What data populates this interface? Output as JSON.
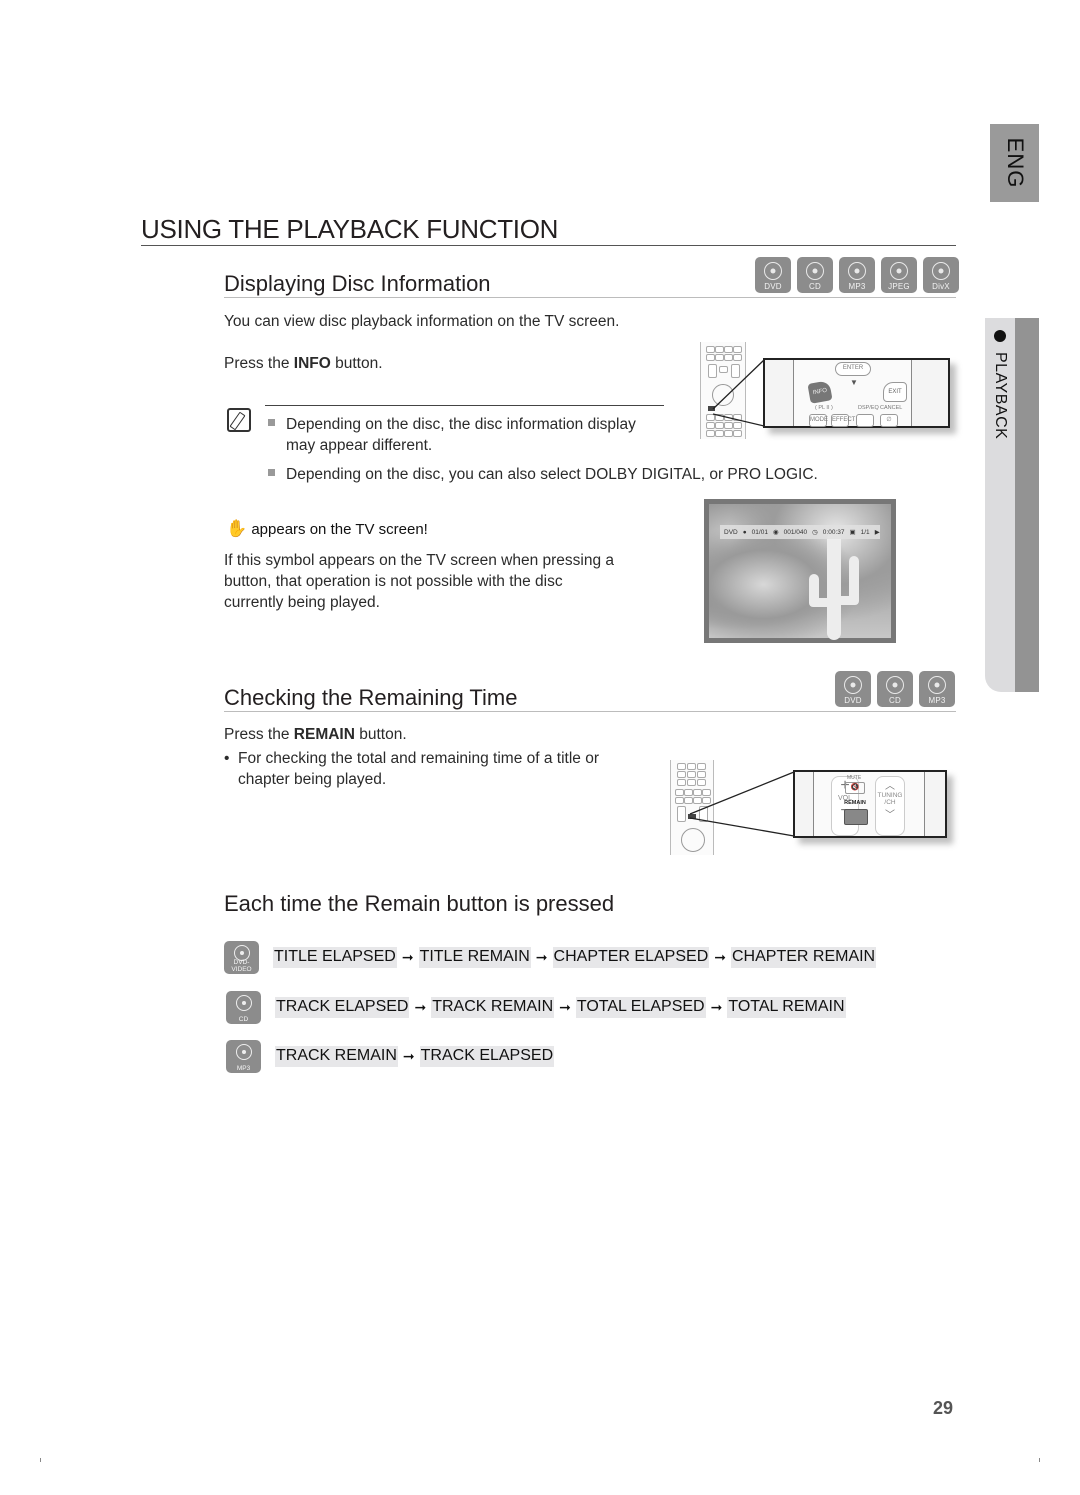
{
  "side_tabs": {
    "language": "ENG",
    "section": "PLAYBACK"
  },
  "title": "USING THE PLAYBACK FUNCTION",
  "section1": {
    "heading": "Displaying Disc Information",
    "disc_badges": [
      "DVD",
      "CD",
      "MP3",
      "JPEG",
      "DivX"
    ],
    "intro": "You can view disc playback information  on the TV screen.",
    "press_prefix": "Press the ",
    "press_button": "INFO",
    "press_suffix": " button.",
    "notes": [
      "Depending on the disc, the disc information display may appear different.",
      "Depending on the disc, you can also select  DOLBY DIGITAL, or PRO LOGIC."
    ],
    "remote_labels": {
      "enter": "ENTER",
      "info": "INFO",
      "exit": "EXIT",
      "plii": "( PL II )",
      "dspeq": "DSP/EQ",
      "cancel": "CANCEL",
      "mode": "MODE",
      "effect": "EFFECT"
    },
    "warning_title": "appears on the TV screen!",
    "warning_text": "If this symbol appears on the TV screen when pressing a button, that operation is not possible with the disc currently being played.",
    "osd": {
      "disc": "DVD",
      "title": "01/01",
      "chapter": "001/040",
      "time": "0:00:37",
      "angle": "1/1"
    }
  },
  "section2": {
    "heading": "Checking the Remaining Time",
    "disc_badges": [
      "DVD",
      "CD",
      "MP3"
    ],
    "press_prefix": "Press the ",
    "press_button": "REMAIN",
    "press_suffix": " button.",
    "bullet": "For checking the total and remaining time of a title or chapter being played.",
    "remote_labels": {
      "mute": "MUTE",
      "vol": "VOL",
      "remain": "REMAIN",
      "tuning": "TUNING",
      "ch": "/CH"
    }
  },
  "section3": {
    "heading": "Each time the Remain button is pressed",
    "sequences": [
      {
        "disc": "DVD-VIDEO",
        "steps": [
          "TITLE ELAPSED",
          "TITLE REMAIN",
          "CHAPTER ELAPSED",
          "CHAPTER REMAIN"
        ]
      },
      {
        "disc": "CD",
        "steps": [
          "TRACK ELAPSED",
          "TRACK REMAIN",
          "TOTAL ELAPSED",
          "TOTAL REMAIN"
        ]
      },
      {
        "disc": "MP3",
        "steps": [
          "TRACK REMAIN",
          "TRACK ELAPSED"
        ]
      }
    ],
    "arrow": "➞"
  },
  "page_number": "29"
}
